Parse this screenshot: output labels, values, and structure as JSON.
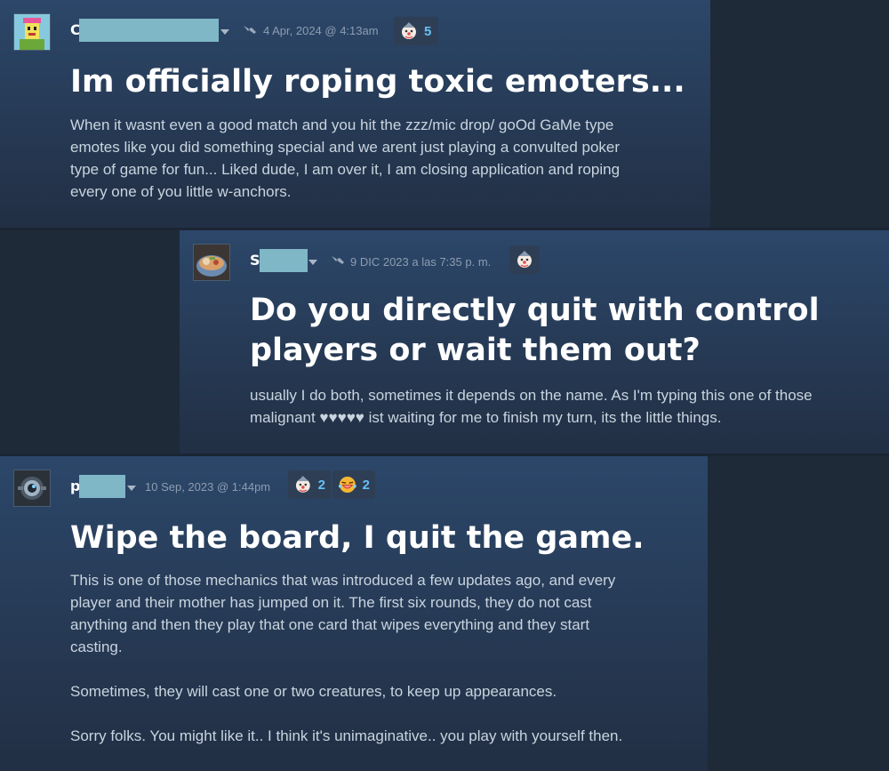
{
  "posts": [
    {
      "username_initial": "C",
      "date": "4 Apr, 2024 @ 4:13am",
      "awards": [
        {
          "icon": "clown-face-icon",
          "count": "5"
        }
      ],
      "title": "Im officially roping toxic emoters...",
      "body": "When it wasnt even a good match and you hit the zzz/mic drop/ goOd GaMe type\nemotes like you did something special and we arent just playing a convulted poker\ntype of game for fun... Liked dude, I am over it, I am closing application and roping\nevery one of you little w-anchors."
    },
    {
      "username_initial": "S",
      "date": "9 DIC 2023 a las 7:35 p. m.",
      "awards": [
        {
          "icon": "clown-face-icon",
          "count": ""
        }
      ],
      "title_line1": "Do you directly quit with control",
      "title_line2": "players or wait them out?",
      "body": "usually I do both, sometimes it depends on the name. As I'm typing this one of those\nmalignant ♥♥♥♥♥ ist waiting for me to finish my turn, its the little things."
    },
    {
      "username_initial": "p",
      "date": "10 Sep, 2023 @ 1:44pm",
      "awards": [
        {
          "icon": "clown-face-icon",
          "count": "2"
        },
        {
          "icon": "laughing-face-icon",
          "count": "2"
        }
      ],
      "title": "Wipe the board, I quit the game.",
      "body": "This is one of those mechanics that was introduced a few updates ago, and every\nplayer and their mother has jumped on it. The first six rounds, they do not cast\nanything and then they play that one card that wipes everything and they start\ncasting.\n\nSometimes, they will cast one or two creatures, to keep up appearances.\n\nSorry folks. You might like it.. I think it's unimaginative.. you play with yourself then."
    }
  ],
  "colors": {
    "accent": "#66c0f4",
    "redaction": "#7fb7c7",
    "card_bg_top": "#2c476a",
    "page_bg": "#1e2a38"
  }
}
